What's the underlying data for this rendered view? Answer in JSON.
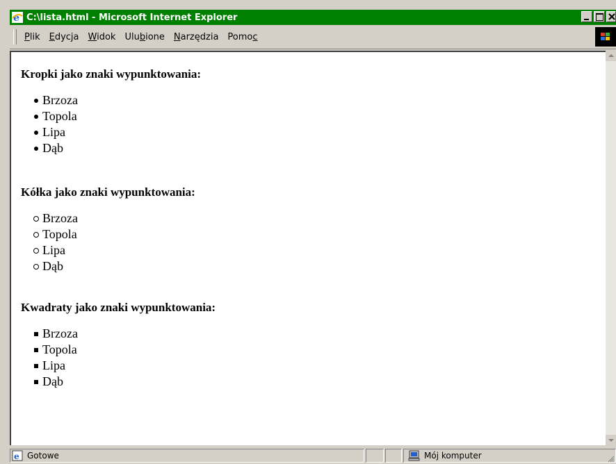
{
  "window": {
    "title": "C:\\lista.html - Microsoft Internet Explorer",
    "buttons": {
      "minimize": "_",
      "maximize": "□",
      "close": "×"
    }
  },
  "menu": [
    {
      "label": "Plik",
      "underline": "P"
    },
    {
      "label": "Edycja",
      "underline": "E"
    },
    {
      "label": "Widok",
      "underline": "W"
    },
    {
      "label": "Ulubione",
      "underline": "b"
    },
    {
      "label": "Narzędzia",
      "underline": "N"
    },
    {
      "label": "Pomoc",
      "underline": "c"
    }
  ],
  "page": {
    "sections": [
      {
        "heading": "Kropki jako znaki wypunktowania:",
        "bullet": "disc",
        "items": [
          "Brzoza",
          "Topola",
          "Lipa",
          "Dąb"
        ]
      },
      {
        "heading": "Kółka jako znaki wypunktowania:",
        "bullet": "circle",
        "items": [
          "Brzoza",
          "Topola",
          "Lipa",
          "Dąb"
        ]
      },
      {
        "heading": "Kwadraty jako znaki wypunktowania:",
        "bullet": "square",
        "items": [
          "Brzoza",
          "Topola",
          "Lipa",
          "Dąb"
        ]
      }
    ]
  },
  "status": {
    "text": "Gotowe",
    "zone": "Mój komputer"
  },
  "colors": {
    "titlebar": "#008000",
    "chrome": "#d4d0c8"
  }
}
